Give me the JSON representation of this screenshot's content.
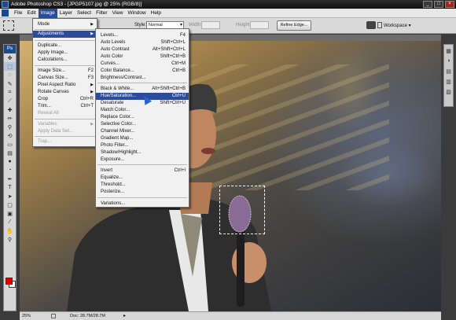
{
  "window": {
    "title": "Adobe Photoshop CS3 - [JPGP5107.jpg @ 25% (RGB/8)]",
    "controls": [
      "_",
      "□",
      "×"
    ]
  },
  "menubar": {
    "items": [
      "File",
      "Edit",
      "Image",
      "Layer",
      "Select",
      "Filter",
      "View",
      "Window",
      "Help"
    ],
    "active": "Image"
  },
  "options": {
    "style_label": "Style:",
    "style_value": "Normal",
    "width_label": "Width:",
    "height_label": "Height:",
    "refine_edge": "Refine Edge...",
    "workspace": "Workspace ▾"
  },
  "toolbox": {
    "logo": "Ps",
    "tools": [
      "move-tool",
      "marquee-tool",
      "lasso-tool",
      "quick-selection-tool",
      "crop-tool",
      "slice-tool",
      "healing-brush-tool",
      "brush-tool",
      "clone-stamp-tool",
      "history-brush-tool",
      "eraser-tool",
      "gradient-tool",
      "blur-tool",
      "dodge-tool",
      "pen-tool",
      "type-tool",
      "path-selection-tool",
      "shape-tool",
      "notes-tool",
      "eyedropper-tool",
      "hand-tool",
      "zoom-tool"
    ],
    "foreground_color": "#e00000",
    "background_color": "#ffffff"
  },
  "image_menu": {
    "items": [
      {
        "label": "Mode",
        "shortcut": "",
        "submenu": true,
        "enabled": true
      },
      {
        "label": "Adjustments",
        "shortcut": "",
        "submenu": true,
        "enabled": true,
        "highlight": true
      },
      {
        "label": "Duplicate...",
        "shortcut": "",
        "enabled": true
      },
      {
        "label": "Apply Image...",
        "shortcut": "",
        "enabled": true
      },
      {
        "label": "Calculations...",
        "shortcut": "",
        "enabled": true
      },
      {
        "label": "Image Size...",
        "shortcut": "F2",
        "enabled": true
      },
      {
        "label": "Canvas Size...",
        "shortcut": "F3",
        "enabled": true
      },
      {
        "label": "Pixel Aspect Ratio",
        "shortcut": "",
        "submenu": true,
        "enabled": true
      },
      {
        "label": "Rotate Canvas",
        "shortcut": "",
        "submenu": true,
        "enabled": true
      },
      {
        "label": "Crop",
        "shortcut": "Ctrl+R",
        "enabled": true
      },
      {
        "label": "Trim...",
        "shortcut": "Ctrl+T",
        "enabled": true
      },
      {
        "label": "Reveal All",
        "shortcut": "",
        "enabled": false
      },
      {
        "label": "Variables",
        "shortcut": "",
        "submenu": true,
        "enabled": false
      },
      {
        "label": "Apply Data Set...",
        "shortcut": "",
        "enabled": false
      },
      {
        "label": "Trap...",
        "shortcut": "",
        "enabled": false
      }
    ]
  },
  "adjustments_menu": {
    "items": [
      {
        "label": "Levels...",
        "shortcut": "F4",
        "enabled": true
      },
      {
        "label": "Auto Levels",
        "shortcut": "Shift+Ctrl+L",
        "enabled": true
      },
      {
        "label": "Auto Contrast",
        "shortcut": "Alt+Shift+Ctrl+L",
        "enabled": true
      },
      {
        "label": "Auto Color",
        "shortcut": "Shift+Ctrl+B",
        "enabled": true
      },
      {
        "label": "Curves...",
        "shortcut": "Ctrl+M",
        "enabled": true
      },
      {
        "label": "Color Balance...",
        "shortcut": "Ctrl+B",
        "enabled": true
      },
      {
        "label": "Brightness/Contrast...",
        "shortcut": "",
        "enabled": true
      },
      {
        "label": "Black & White...",
        "shortcut": "Alt+Shift+Ctrl+B",
        "enabled": true
      },
      {
        "label": "Hue/Saturation...",
        "shortcut": "Ctrl+U",
        "enabled": true,
        "highlight": true
      },
      {
        "label": "Desaturate",
        "shortcut": "Shift+Ctrl+U",
        "enabled": true
      },
      {
        "label": "Match Color...",
        "shortcut": "",
        "enabled": true
      },
      {
        "label": "Replace Color...",
        "shortcut": "",
        "enabled": true
      },
      {
        "label": "Selective Color...",
        "shortcut": "",
        "enabled": true
      },
      {
        "label": "Channel Mixer...",
        "shortcut": "",
        "enabled": true
      },
      {
        "label": "Gradient Map...",
        "shortcut": "",
        "enabled": true
      },
      {
        "label": "Photo Filter...",
        "shortcut": "",
        "enabled": true
      },
      {
        "label": "Shadow/Highlight...",
        "shortcut": "",
        "enabled": true
      },
      {
        "label": "Exposure...",
        "shortcut": "",
        "enabled": true
      },
      {
        "label": "Invert",
        "shortcut": "Ctrl+I",
        "enabled": true
      },
      {
        "label": "Equalize...",
        "shortcut": "",
        "enabled": true
      },
      {
        "label": "Threshold...",
        "shortcut": "",
        "enabled": true
      },
      {
        "label": "Posterize...",
        "shortcut": "",
        "enabled": true
      },
      {
        "label": "Variations...",
        "shortcut": "",
        "enabled": true
      }
    ]
  },
  "statusbar": {
    "zoom": "25%",
    "doc": "Doc: 28.7M/28.7M"
  },
  "colors": {
    "menu_highlight": "#2b4c9a",
    "titlebar": "#1a1a1a"
  }
}
